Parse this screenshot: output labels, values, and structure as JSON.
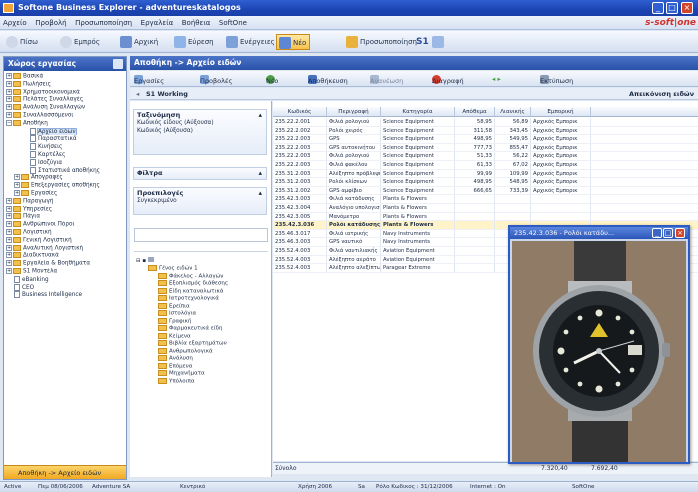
{
  "window": {
    "title": "Softone Business Explorer - adventureskatalogos",
    "controls": [
      "_",
      "□",
      "×"
    ]
  },
  "menubar": {
    "items": [
      "Αρχείο",
      "Προβολή",
      "Προσωποποίηση",
      "Εργαλεία",
      "Βοήθεια",
      "SoftOne"
    ],
    "brand": "s-soft|one"
  },
  "toolbar": {
    "buttons": [
      {
        "label": "Πίσω",
        "icon": "back-icon"
      },
      {
        "label": "Εμπρός",
        "icon": "forward-icon"
      },
      {
        "label": "Αρχική",
        "icon": "home-icon"
      },
      {
        "label": "Εύρεση",
        "icon": "search-icon"
      },
      {
        "label": "Ενέργειες",
        "icon": "actions-icon"
      },
      {
        "label": "Νέο",
        "icon": "new-icon",
        "active": true
      },
      {
        "label": "Προσωποποίηση",
        "icon": "customize-icon"
      },
      {
        "label": "S1",
        "icon": "s1-icon"
      }
    ]
  },
  "nav": {
    "header": "Χώρος εργασίας",
    "tree": [
      {
        "label": "Βασικά",
        "level": 0,
        "type": "folder",
        "exp": "+"
      },
      {
        "label": "Πωλήσεις",
        "level": 0,
        "type": "folder",
        "exp": "+"
      },
      {
        "label": "Χρηματοοικονομικά",
        "level": 0,
        "type": "folder",
        "exp": "+"
      },
      {
        "label": "Πελάτες Συναλλαγές",
        "level": 0,
        "type": "folder",
        "exp": "+"
      },
      {
        "label": "Ανάλυση Συναλλαγών",
        "level": 0,
        "type": "folder",
        "exp": "+"
      },
      {
        "label": "Συναλλασσόμενοι",
        "level": 0,
        "type": "folder",
        "exp": "+"
      },
      {
        "label": "Αποθήκη",
        "level": 0,
        "type": "folder",
        "exp": "−"
      },
      {
        "label": "Αρχείο ειδών",
        "level": 2,
        "type": "doc",
        "selected": true
      },
      {
        "label": "Παραστατικά",
        "level": 2,
        "type": "doc"
      },
      {
        "label": "Κινήσεις",
        "level": 2,
        "type": "doc"
      },
      {
        "label": "Καρτέλες",
        "level": 2,
        "type": "doc"
      },
      {
        "label": "Ισοζύγια",
        "level": 2,
        "type": "doc"
      },
      {
        "label": "Στατιστικά αποθήκης",
        "level": 2,
        "type": "doc"
      },
      {
        "label": "Απογραφές",
        "level": 1,
        "type": "folder",
        "exp": "+"
      },
      {
        "label": "Επεξεργασίες αποθήκης",
        "level": 1,
        "type": "folder",
        "exp": "+"
      },
      {
        "label": "Εργασίες",
        "level": 1,
        "type": "folder",
        "exp": "+"
      },
      {
        "label": "Παραγωγή",
        "level": 0,
        "type": "folder",
        "exp": "+"
      },
      {
        "label": "Υπηρεσίες",
        "level": 0,
        "type": "folder",
        "exp": "+"
      },
      {
        "label": "Πάγια",
        "level": 0,
        "type": "folder",
        "exp": "+"
      },
      {
        "label": "Ανθρώπινοι Πόροι",
        "level": 0,
        "type": "folder",
        "exp": "+"
      },
      {
        "label": "Λογιστική",
        "level": 0,
        "type": "folder",
        "exp": "+"
      },
      {
        "label": "Γενική Λογιστική",
        "level": 0,
        "type": "folder",
        "exp": "+"
      },
      {
        "label": "Αναλυτική Λογιστική",
        "level": 0,
        "type": "folder",
        "exp": "+"
      },
      {
        "label": "Διαδικτυακά",
        "level": 0,
        "type": "folder",
        "exp": "+"
      },
      {
        "label": "Εργαλεία & Βοηθήματα",
        "level": 0,
        "type": "folder",
        "exp": "+"
      },
      {
        "label": "S1 Μοντέλα",
        "level": 0,
        "type": "folder",
        "exp": "+"
      },
      {
        "label": "eBanking",
        "level": 0,
        "type": "doc"
      },
      {
        "label": "CEO",
        "level": 0,
        "type": "doc"
      },
      {
        "label": "Business Intelligence",
        "level": 0,
        "type": "doc"
      }
    ],
    "footer": "Αποθήκη -> Αρχείο ειδών"
  },
  "breadcrumb": "Αποθήκη -> Αρχείο ειδών",
  "actions": [
    {
      "label": "Εργασίες",
      "icon": "tasks-icon"
    },
    {
      "label": "Προβολές",
      "icon": "views-icon"
    },
    {
      "label": "Νέο",
      "icon": "new-record-icon"
    },
    {
      "label": "Αποθήκευση",
      "icon": "save-icon"
    },
    {
      "label": "Ανανέωση",
      "icon": "refresh-icon"
    },
    {
      "label": "Διαγραφή",
      "icon": "delete-icon"
    },
    {
      "label": "Εκτύπωση",
      "icon": "print-icon"
    }
  ],
  "subheader": {
    "left": "S1 Working",
    "right": "Απεικόνιση ειδών"
  },
  "filters": {
    "sort_title": "Ταξινόμηση",
    "sort_lines": [
      "Κωδικός είδους (Αύξουσα)",
      "Κωδικός (Αύξουσα)"
    ],
    "filters_title": "Φίλτρα",
    "preset_title": "Προεπιλογές",
    "preset_line": "Συγκεκριμένο",
    "folders_root": "Γένος ειδών 1",
    "folders": [
      "Φάκελος - Αλλαγών",
      "Εξοπλισμός διάθεσης",
      "Είδη καταναλωτικά",
      "Ιατροτεχνολογικά",
      "Ερείπια",
      "Ιστολόγια",
      "Γραφική",
      "Φαρμακευτικά είδη",
      "Κείμενα",
      "Βιβλία εξαρτημάτων",
      "Ανθρωπολογικά",
      "Ανάλυση",
      "Επόμενα",
      "Μηχανήματα",
      "Υπόλοιπα"
    ]
  },
  "grid": {
    "columns": [
      "Κωδικός",
      "Περιγραφή",
      "Κατηγορία",
      "Απόθεμα",
      "Λιανικής",
      "Εμπορική"
    ],
    "rows": [
      [
        "235.22.2.001",
        "Φιλιά ρολογιού",
        "Science Equipment",
        "58,95",
        "56,89",
        "Αρχικός Εμπορικ"
      ],
      [
        "235.22.2.002",
        "Ρολόι χειρός",
        "Science Equipment",
        "311,58",
        "343,45",
        "Αρχικός Εμπορικ"
      ],
      [
        "235.22.2.003",
        "GPS",
        "Science Equipment",
        "498,95",
        "549,95",
        "Αρχικός Εμπορικ"
      ],
      [
        "235.22.2.003",
        "GPS αυτοκινήτου",
        "Science Equipment",
        "777,73",
        "855,47",
        "Αρχικός Εμπορικ"
      ],
      [
        "235.22.2.003",
        "Φιλιά ρολογιού",
        "Science Equipment",
        "51,33",
        "56,22",
        "Αρχικός Εμπορικ"
      ],
      [
        "235.22.2.003",
        "Φιλιά φακέλου",
        "Science Equipment",
        "61,33",
        "67,02",
        "Αρχικός Εμπορικ"
      ],
      [
        "235.31.2.003",
        "Αλέξηπτο πρόβλεψης",
        "Science Equipment",
        "99,99",
        "109,99",
        "Αρχικός Εμπορικ"
      ],
      [
        "235.31.2.003",
        "Ρολόι κλίσεων",
        "Science Equipment",
        "498,95",
        "548,95",
        "Αρχικός Εμπορικ"
      ],
      [
        "235.31.2.002",
        "GPS αμφίβιο",
        "Science Equipment",
        "666,65",
        "733,39",
        "Αρχικός Εμπορικ"
      ],
      [
        "235.42.3.003",
        "Φιλιά κατάδυσης",
        "Plants & Flowers",
        "",
        "",
        ""
      ],
      [
        "235.42.3.004",
        "Αναλόγιο υπολογισμ",
        "Plants & Flowers",
        "",
        "",
        ""
      ],
      [
        "235.42.3.005",
        "Μανόμετρο",
        "Plants & Flowers",
        "",
        "",
        ""
      ],
      [
        "235.42.3.036",
        "Ρολόι κατάδυσης",
        "Plants & Flowers",
        "",
        "",
        ""
      ],
      [
        "235.46.3.017",
        "Φιλιά ιατρικής",
        "Navy Instruments",
        "",
        "",
        ""
      ],
      [
        "235.46.3.003",
        "GPS ναυτικό",
        "Navy Instruments",
        "",
        "",
        ""
      ],
      [
        "235.52.4.003",
        "Φιλιά ναυτιλιακής",
        "Aviation Equipment",
        "",
        "",
        ""
      ],
      [
        "235.52.4.003",
        "Αλέξηπτο αεράτο",
        "Aviation Equipment",
        "",
        "",
        ""
      ],
      [
        "235.52.4.003",
        "Αλέξηπτο αλεξίπτωτου",
        "Paragear Extreme",
        "",
        "",
        ""
      ]
    ],
    "highlighted_row": 12,
    "footer_label": "Σύνολο",
    "footer_total1": "7.320,40",
    "footer_total2": "7.692,40"
  },
  "image_window": {
    "title": "235.42.3.036 - Ρολόι κατάδυ...",
    "controls": [
      "_",
      "□",
      "×"
    ]
  },
  "status": {
    "mode": "Active",
    "date": "Πεμ 08/06/2006",
    "company": "Adventure SA",
    "branch": "Κεντρικό",
    "year": "Χρήση 2006",
    "user": "Sa",
    "last_code": "Ρόλο Κωδικος : 31/12/2006",
    "internet": "Internet : On",
    "softone": "SoftOne"
  },
  "colors": {
    "titlebar": "#1c45b4",
    "accent": "#f2a821",
    "highlight_row": "#fff4c9"
  }
}
